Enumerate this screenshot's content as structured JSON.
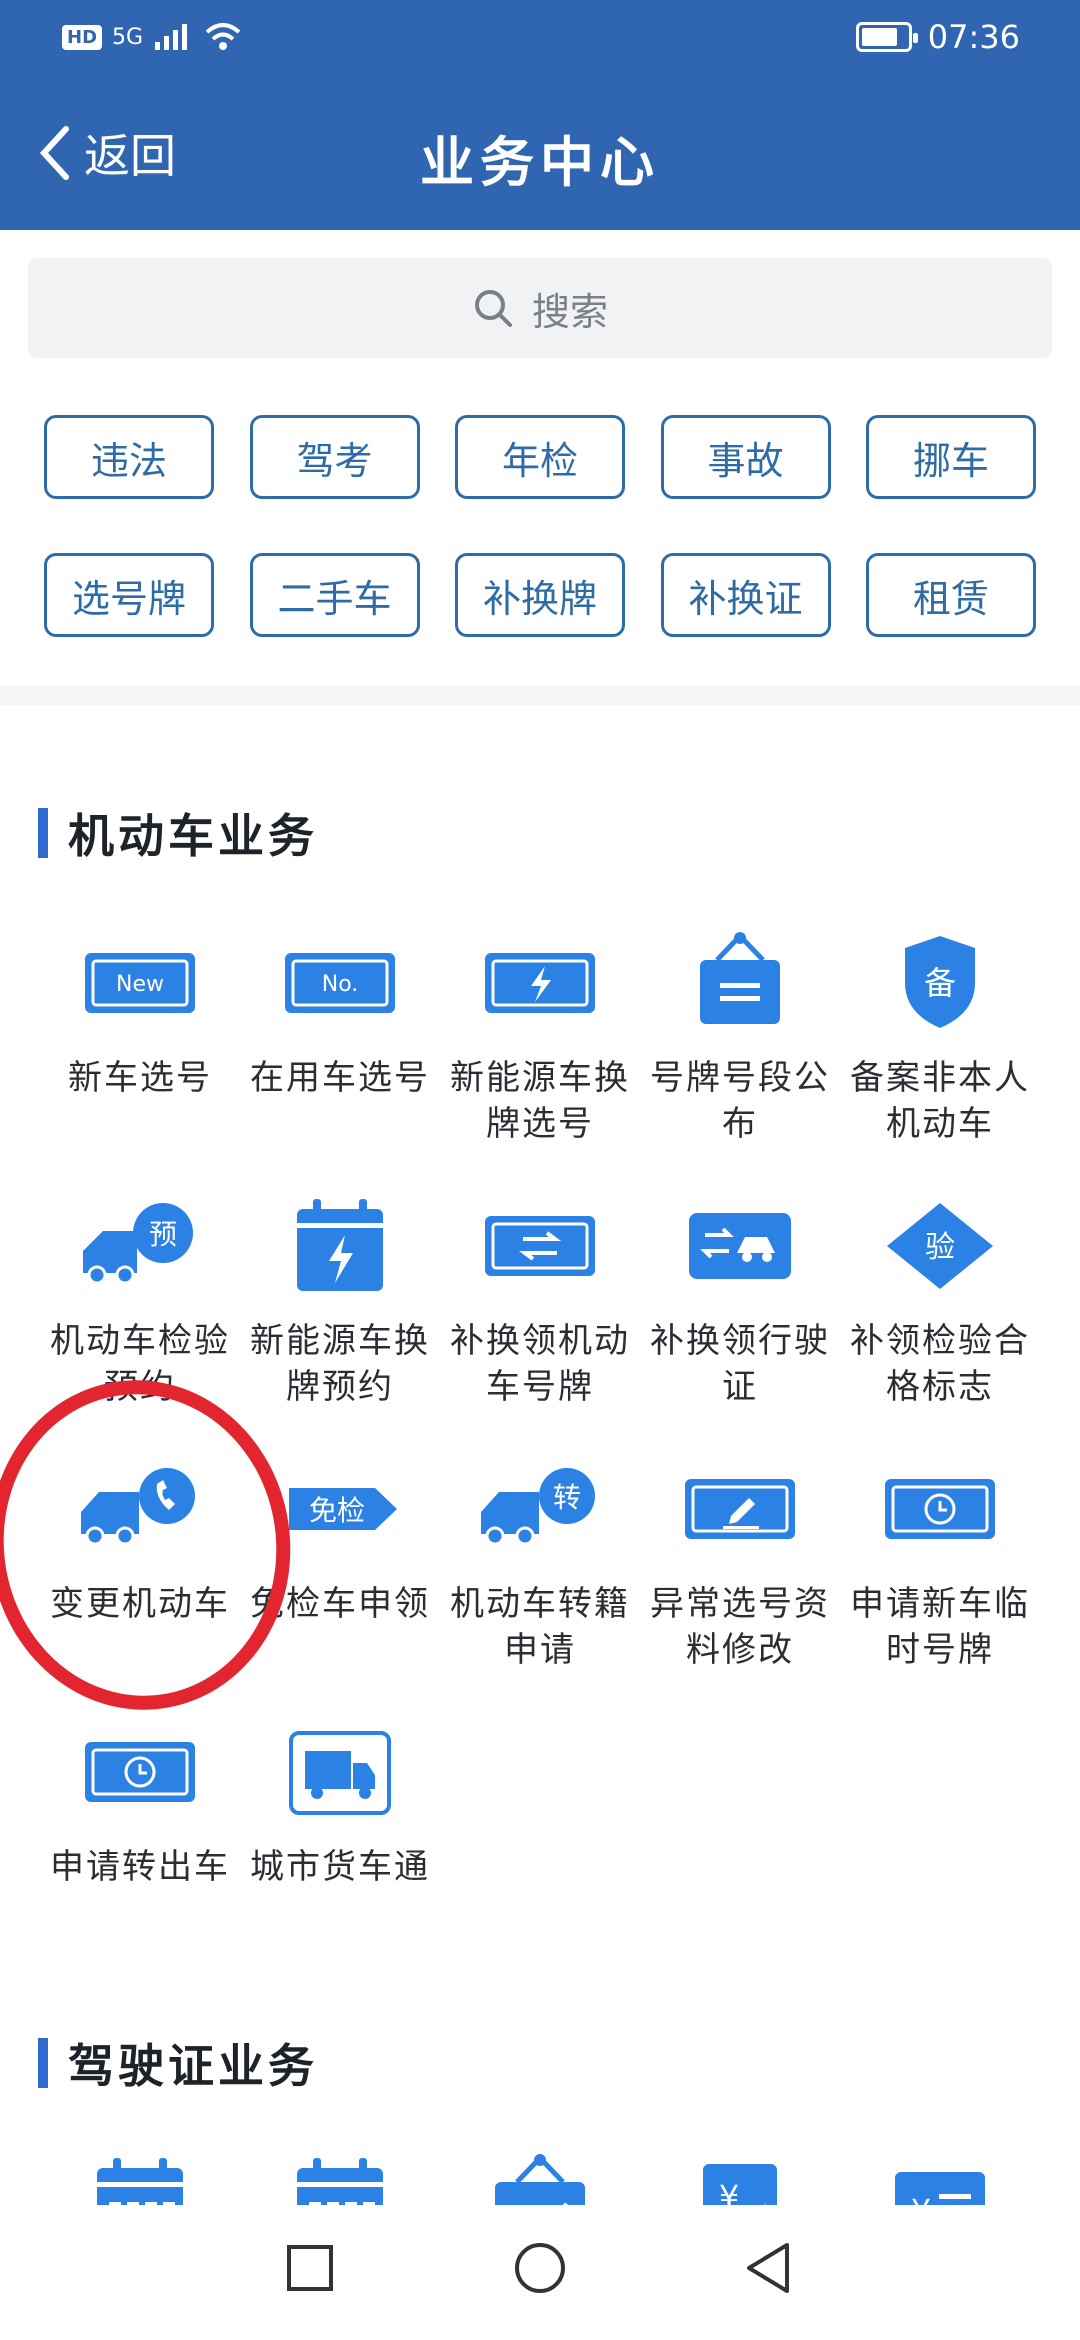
{
  "status_bar": {
    "hd": "HD",
    "network": "5G",
    "time": "07:36"
  },
  "header": {
    "back_label": "返回",
    "title": "业务中心"
  },
  "search": {
    "placeholder": "搜索"
  },
  "tags": [
    "违法",
    "驾考",
    "年检",
    "事故",
    "挪车",
    "选号牌",
    "二手车",
    "补换牌",
    "补换证",
    "租赁"
  ],
  "sections": {
    "vehicle": {
      "title": "机动车业务",
      "items": [
        {
          "label": "新车选号",
          "icon": "new-plate-icon"
        },
        {
          "label": "在用车选号",
          "icon": "no-plate-icon"
        },
        {
          "label": "新能源车换牌选号",
          "icon": "ev-plate-icon"
        },
        {
          "label": "号牌号段公布",
          "icon": "hanging-sign-icon"
        },
        {
          "label": "备案非本人机动车",
          "icon": "shield-record-icon"
        },
        {
          "label": "机动车检验预约",
          "icon": "truck-appointment-icon"
        },
        {
          "label": "新能源车换牌预约",
          "icon": "ev-calendar-icon"
        },
        {
          "label": "补换领机动车号牌",
          "icon": "swap-plate-icon"
        },
        {
          "label": "补换领行驶证",
          "icon": "swap-car-icon"
        },
        {
          "label": "补领检验合格标志",
          "icon": "inspection-diamond-icon"
        },
        {
          "label": "变更机动车",
          "icon": "truck-phone-icon"
        },
        {
          "label": "免检车申领",
          "icon": "exempt-tag-icon"
        },
        {
          "label": "机动车转籍申请",
          "icon": "truck-transfer-icon"
        },
        {
          "label": "异常选号资料修改",
          "icon": "edit-plate-icon"
        },
        {
          "label": "申请新车临时号牌",
          "icon": "clock-plate-icon"
        },
        {
          "label": "申请转出车",
          "icon": "clock-plate-icon"
        },
        {
          "label": "城市货车通",
          "icon": "cargo-truck-icon"
        }
      ]
    },
    "license": {
      "title": "驾驶证业务",
      "icons": [
        "calendar-icon",
        "calendar-icon",
        "sign-check-icon",
        "yen-edit-icon",
        "yen-list-icon"
      ]
    }
  },
  "colors": {
    "header": "#2f65b1",
    "accent": "#2f6ad1",
    "icon_blue": "#2b82e4",
    "annotation_red": "#e32530"
  }
}
